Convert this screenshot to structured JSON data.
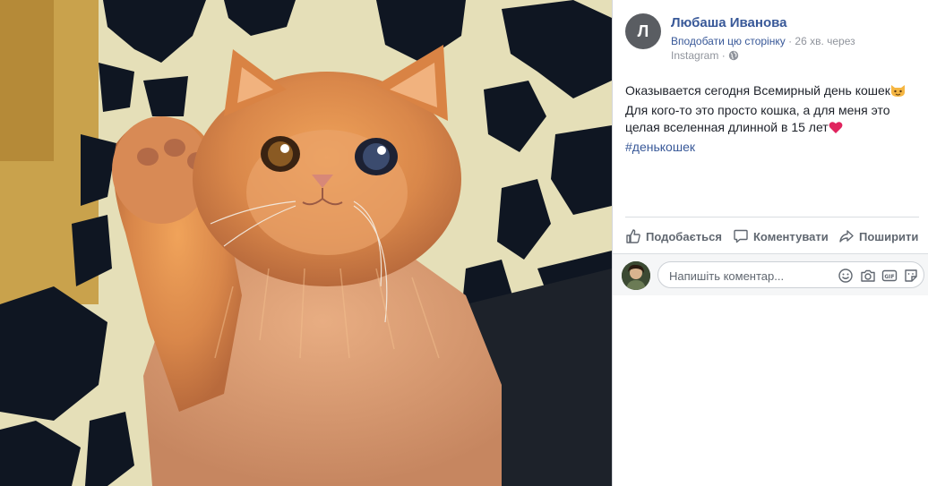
{
  "post": {
    "author_initial": "Л",
    "author_name": "Любаша Иванова",
    "follow_link": "Вподобати цю сторінку",
    "separator": " · ",
    "time_text": "26 хв. через",
    "source": "Instagram",
    "source_suffix": " · ",
    "text_line1": "Оказывается сегодня Всемирный день кошек",
    "text_line2": "Для кого-то это просто кошка, а для меня это",
    "text_line3": "целая вселенная длинной в 15 лет",
    "hashtag": "#денькошек"
  },
  "actions": {
    "like": "Подобається",
    "comment": "Коментувати",
    "share": "Поширити"
  },
  "comment_input": {
    "placeholder": "Напишіть коментар..."
  },
  "icons": {
    "privacy": "globe-icon",
    "like": "thumbs-up-icon",
    "comment": "speech-bubble-icon",
    "share": "share-arrow-icon",
    "emoji": "smiley-icon",
    "camera": "camera-icon",
    "gif": "gif-icon",
    "sticker": "sticker-icon",
    "cat_emoji": "cat-face-emoji",
    "heart_emoji": "red-heart-emoji"
  },
  "colors": {
    "link": "#385898",
    "secondary_text": "#90949c",
    "action_text": "#606770",
    "heart": "#e0245e",
    "cat_face": "#f5b642"
  }
}
